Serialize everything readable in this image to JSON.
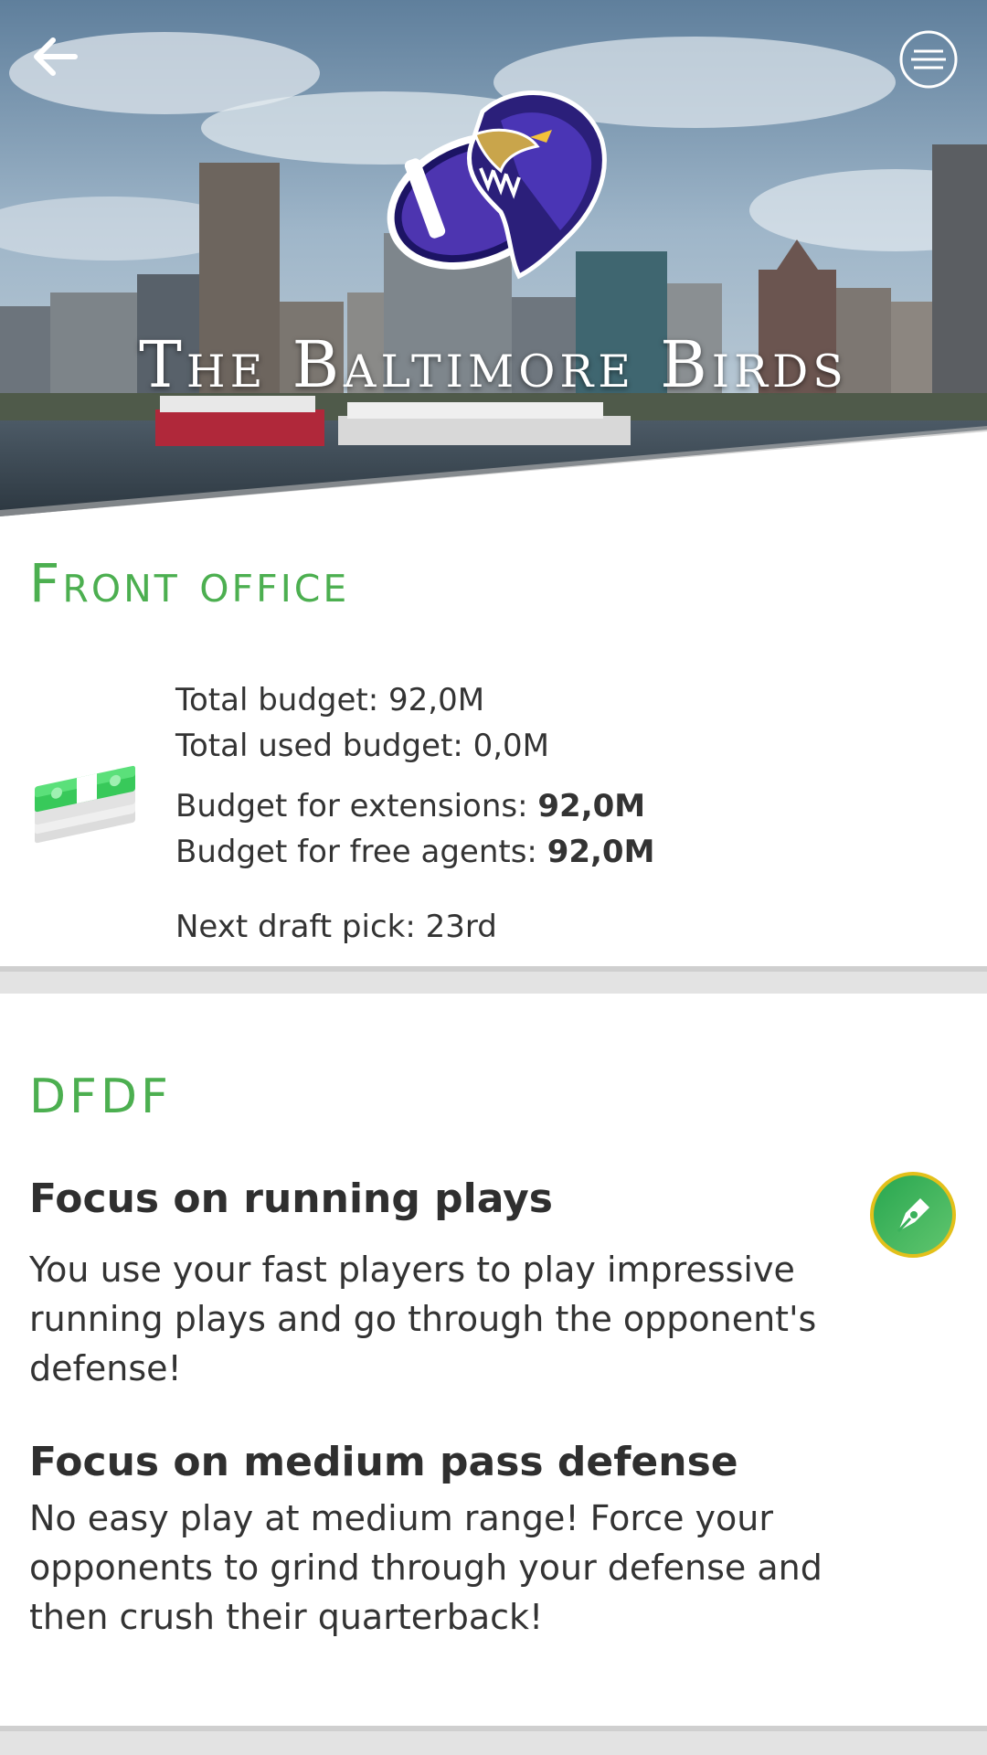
{
  "header": {
    "team_name": "The Baltimore Birds",
    "back_icon": "arrow-left-icon",
    "menu_icon": "hamburger-menu-icon",
    "logo": "baltimore-birds-logo"
  },
  "front_office": {
    "heading": "Front office",
    "icon": "money-stack-icon",
    "total_budget": "Total budget: 92,0M",
    "total_used_budget": "Total used budget: 0,0M",
    "extensions_label": "Budget for extensions: ",
    "extensions_value": "92,0M",
    "free_agents_label": "Budget for free agents: ",
    "free_agents_value": "92,0M",
    "next_draft_pick": "Next draft pick: 23rd"
  },
  "strategy": {
    "heading": "DFDF",
    "edit_icon": "pen-edit-icon",
    "items": [
      {
        "title": "Focus on running plays",
        "description": "You use your fast players to play impressive running plays and go through the opponent's defense!"
      },
      {
        "title": "Focus on medium pass defense",
        "description": "No easy play at medium range! Force your opponents to grind through your defense and then crush their quarterback!"
      }
    ]
  },
  "colors": {
    "accent_green": "#4caf50",
    "edit_button_border": "#e3c01a",
    "divider_gray": "#e3e3e3"
  }
}
